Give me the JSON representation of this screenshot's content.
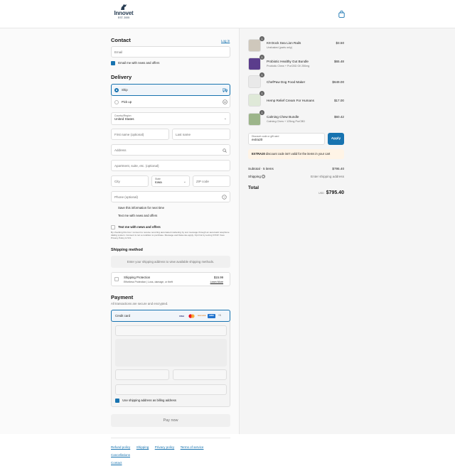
{
  "header": {
    "brand_name": "Innovet",
    "brand_sub": "EST. 2005"
  },
  "contact": {
    "title": "Contact",
    "login_link": "Log in",
    "email_placeholder": "Email",
    "newsletter_label": "Email me with news and offers"
  },
  "delivery": {
    "title": "Delivery",
    "options": [
      {
        "label": "Ship",
        "selected": true
      },
      {
        "label": "Pick up",
        "selected": false
      }
    ],
    "country_label": "Country/Region",
    "country_value": "United States",
    "first_name_placeholder": "First name (optional)",
    "last_name_placeholder": "Last name",
    "address_placeholder": "Address",
    "apartment_placeholder": "Apartment, suite, etc. (optional)",
    "city_placeholder": "City",
    "state_label": "State",
    "state_value": "Iowa",
    "zip_placeholder": "ZIP code",
    "phone_placeholder": "Phone (optional)",
    "save_info_label": "Save this information for next time",
    "text_offers_label": "Text me with news and offers",
    "sms_heading": "Text me with news and offers",
    "sms_disclaimer": "By checking this box I consent to receive recurring automated marketing by text message through an automatic telephone dialing system. Consent is not a condition to purchase. Message and Data rate apply. Opt Out by texting STOP. View Privacy Policy & ToS"
  },
  "shipping_method": {
    "title": "Shipping method",
    "placeholder_text": "Enter your shipping address to view available shipping methods.",
    "protection_title": "Shipping Protection",
    "protection_desc": "Effortless Protection | Loss, damage, or theft",
    "protection_price": "$15.99",
    "learn_more": "Learn More"
  },
  "payment": {
    "title": "Payment",
    "subtitle": "All transactions are secure and encrypted.",
    "method_label": "Credit card",
    "card_brands": [
      "VISA",
      "MC",
      "DISCOVER",
      "AMEX",
      "+5"
    ],
    "billing_label": "Use shipping address as billing address",
    "pay_button": "Pay now"
  },
  "footer": {
    "links": [
      "Refund policy",
      "Shipping",
      "Privacy policy",
      "Terms of service",
      "Cancellations",
      "Contact"
    ]
  },
  "order": {
    "items": [
      {
        "qty": "1",
        "name": "K9 Dock Sea Lion Rails",
        "variant": "Unshaked (parts only)",
        "price": "$3.50"
      },
      {
        "qty": "1",
        "name": "Probiotic Healthy Gut Bundle",
        "variant": "Probiotic Chew + PurCBD Oil 250mg",
        "price": "$65.48"
      },
      {
        "qty": "1",
        "name": "ChefPaw Dog Food Maker",
        "variant": "",
        "price": "$649.00"
      },
      {
        "qty": "1",
        "name": "Hemp Relief Cream For Humans",
        "variant": "",
        "price": "$17.00"
      },
      {
        "qty": "1",
        "name": "Calming Chew Bundle",
        "variant": "Calming Chew + 125mg PurCBD",
        "price": "$60.42"
      }
    ],
    "discount_label": "Discount code or gift card",
    "discount_value": "extra20",
    "apply_button": "Apply",
    "discount_error_code": "EXTRA20",
    "discount_error_text": "discount code isn't valid for the items in your cart",
    "subtotal_label": "Subtotal · 5 items",
    "subtotal_value": "$795.40",
    "shipping_label": "Shipping",
    "shipping_value": "Enter shipping address",
    "total_label": "Total",
    "currency": "USD",
    "total_value": "$795.40"
  },
  "colors": {
    "accent": "#1773b0",
    "brand": "#2a3f55"
  }
}
